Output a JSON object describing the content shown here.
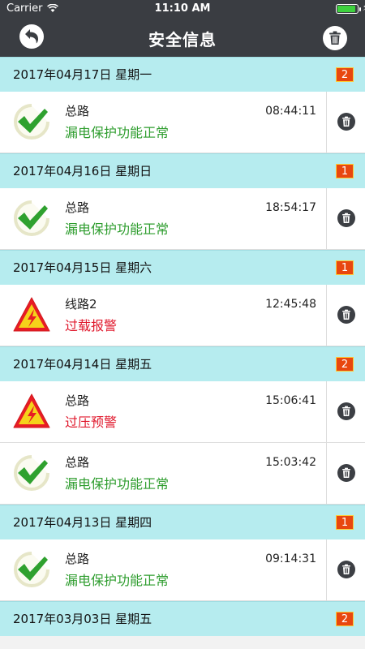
{
  "status_bar": {
    "carrier": "Carrier",
    "time": "11:10 AM"
  },
  "nav": {
    "title": "安全信息",
    "back_icon": "back-arrow-icon",
    "trash_icon": "trash-icon"
  },
  "colors": {
    "header_bar": "#3a3d42",
    "day_header_bg": "#b6ecef",
    "badge_bg": "#e8470f",
    "status_ok": "#2e9d2e",
    "status_warn": "#e0192d"
  },
  "days": [
    {
      "date": "2017年04月17日  星期一",
      "count": "2",
      "events": [
        {
          "source": "总路",
          "status": "漏电保护功能正常",
          "kind": "ok",
          "time": "08:44:11"
        }
      ]
    },
    {
      "date": "2017年04月16日  星期日",
      "count": "1",
      "events": [
        {
          "source": "总路",
          "status": "漏电保护功能正常",
          "kind": "ok",
          "time": "18:54:17"
        }
      ]
    },
    {
      "date": "2017年04月15日  星期六",
      "count": "1",
      "events": [
        {
          "source": "线路2",
          "status": "过载报警",
          "kind": "warn",
          "time": "12:45:48"
        }
      ]
    },
    {
      "date": "2017年04月14日  星期五",
      "count": "2",
      "events": [
        {
          "source": "总路",
          "status": "过压预警",
          "kind": "warn",
          "time": "15:06:41"
        },
        {
          "source": "总路",
          "status": "漏电保护功能正常",
          "kind": "ok",
          "time": "15:03:42"
        }
      ]
    },
    {
      "date": "2017年04月13日  星期四",
      "count": "1",
      "events": [
        {
          "source": "总路",
          "status": "漏电保护功能正常",
          "kind": "ok",
          "time": "09:14:31"
        }
      ]
    },
    {
      "date": "2017年03月03日  星期五",
      "count": "2",
      "events": []
    }
  ]
}
